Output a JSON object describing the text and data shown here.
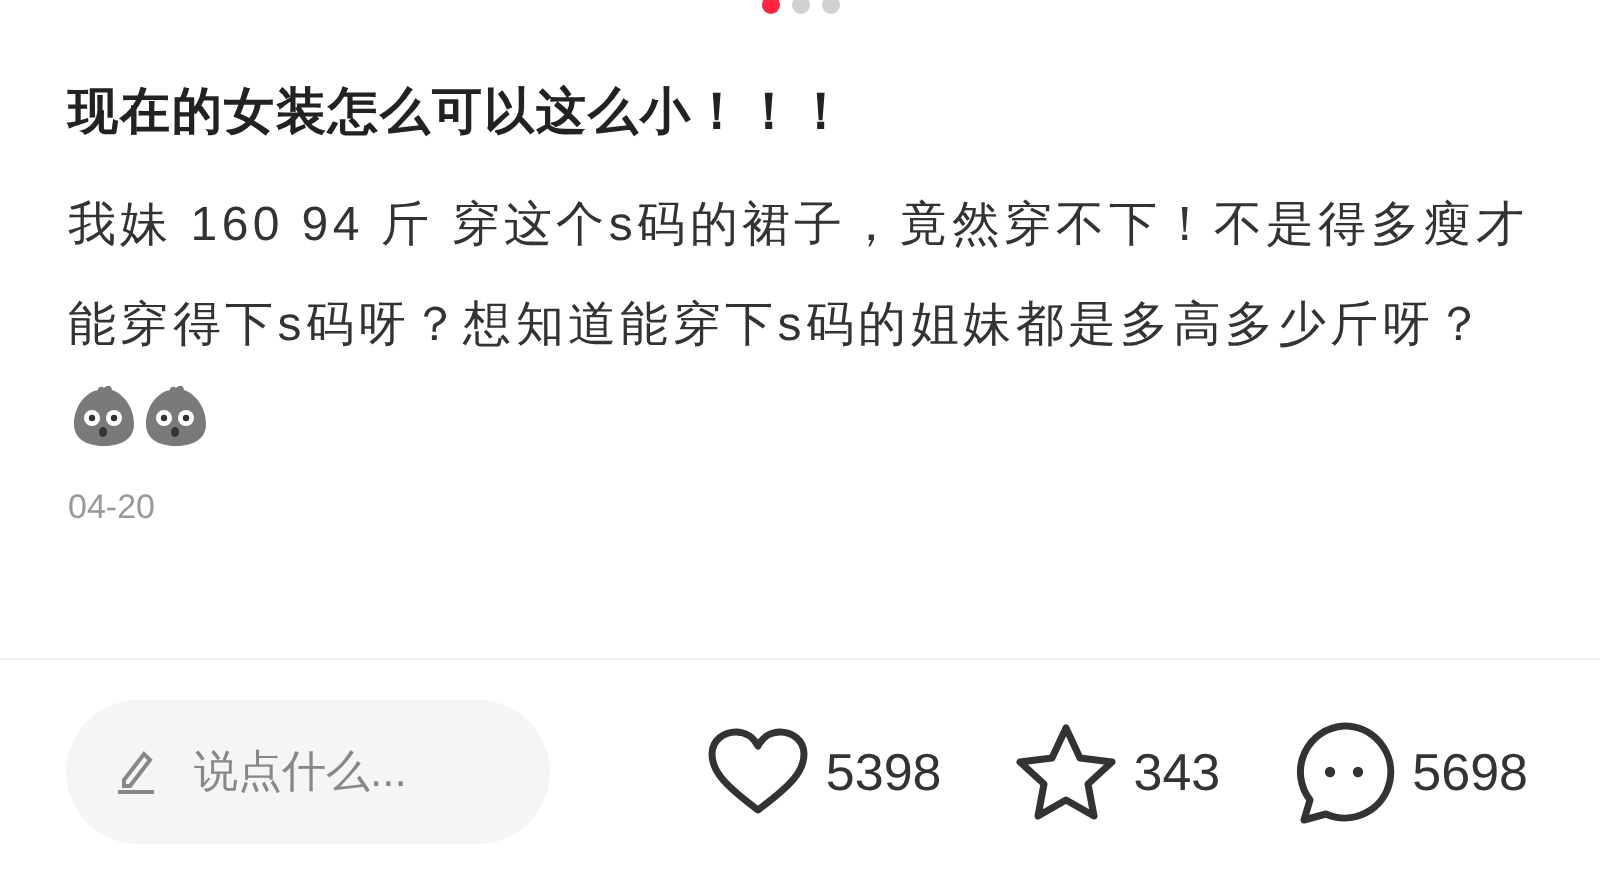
{
  "carousel": {
    "dots": [
      {
        "selected": true
      },
      {
        "selected": false
      },
      {
        "selected": false
      }
    ]
  },
  "post": {
    "title": "现在的女装怎么可以这么小！！！",
    "body": "我妹 160 94 斤 穿这个s码的裙子，竟然穿不下！不是得多瘦才能穿得下s码呀？想知道能穿下s码的姐妹都是多高多少斤呀？",
    "date": "04-20"
  },
  "comment_field": {
    "placeholder": "说点什么..."
  },
  "actions": [
    {
      "kind": "like",
      "count": "5398"
    },
    {
      "kind": "star",
      "count": "343"
    },
    {
      "kind": "comment",
      "count": "5698"
    }
  ]
}
